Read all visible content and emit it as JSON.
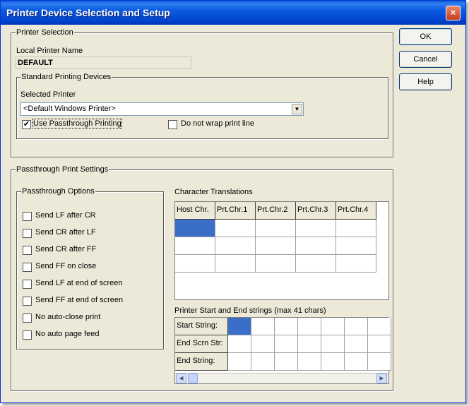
{
  "window": {
    "title": "Printer Device Selection and Setup",
    "close_glyph": "×"
  },
  "buttons": {
    "ok": "OK",
    "cancel": "Cancel",
    "help": "Help"
  },
  "printer_selection": {
    "group_label": "Printer Selection",
    "local_name_label": "Local Printer Name",
    "local_name_value": "DEFAULT",
    "std_group_label": "Standard Printing Devices",
    "selected_printer_label": "Selected Printer",
    "selected_printer_value": "<Default Windows Printer>",
    "use_passthrough_label": "Use Passthrough Printing",
    "use_passthrough_checked": true,
    "no_wrap_label": "Do not wrap print line",
    "no_wrap_checked": false
  },
  "passthrough": {
    "group_label": "Passthrough Print Settings",
    "options_label": "Passthrough Options",
    "options": [
      {
        "label": "Send LF after CR",
        "checked": false
      },
      {
        "label": "Send CR after LF",
        "checked": false
      },
      {
        "label": "Send CR after FF",
        "checked": false
      },
      {
        "label": "Send FF on close",
        "checked": false
      },
      {
        "label": "Send LF at end of screen",
        "checked": false
      },
      {
        "label": "Send FF at end of screen",
        "checked": false
      },
      {
        "label": "No auto-close print",
        "checked": false
      },
      {
        "label": "No auto page feed",
        "checked": false
      }
    ],
    "char_translations_label": "Character Translations",
    "char_columns": [
      "Host Chr.",
      "Prt.Chr.1",
      "Prt.Chr.2",
      "Prt.Chr.3",
      "Prt.Chr.4"
    ],
    "start_end_label": "Printer Start and End strings (max 41 chars)",
    "string_rows": [
      "Start String:",
      "End Scrn Str:",
      "End String:"
    ]
  },
  "icons": {
    "check": "✔",
    "dropdown": "▼",
    "scroll_left": "◀",
    "scroll_right": "▶"
  },
  "colors": {
    "titlebar": "#0a5bd6",
    "dialog_bg": "#ece9d8",
    "selection": "#3b6ec9"
  }
}
